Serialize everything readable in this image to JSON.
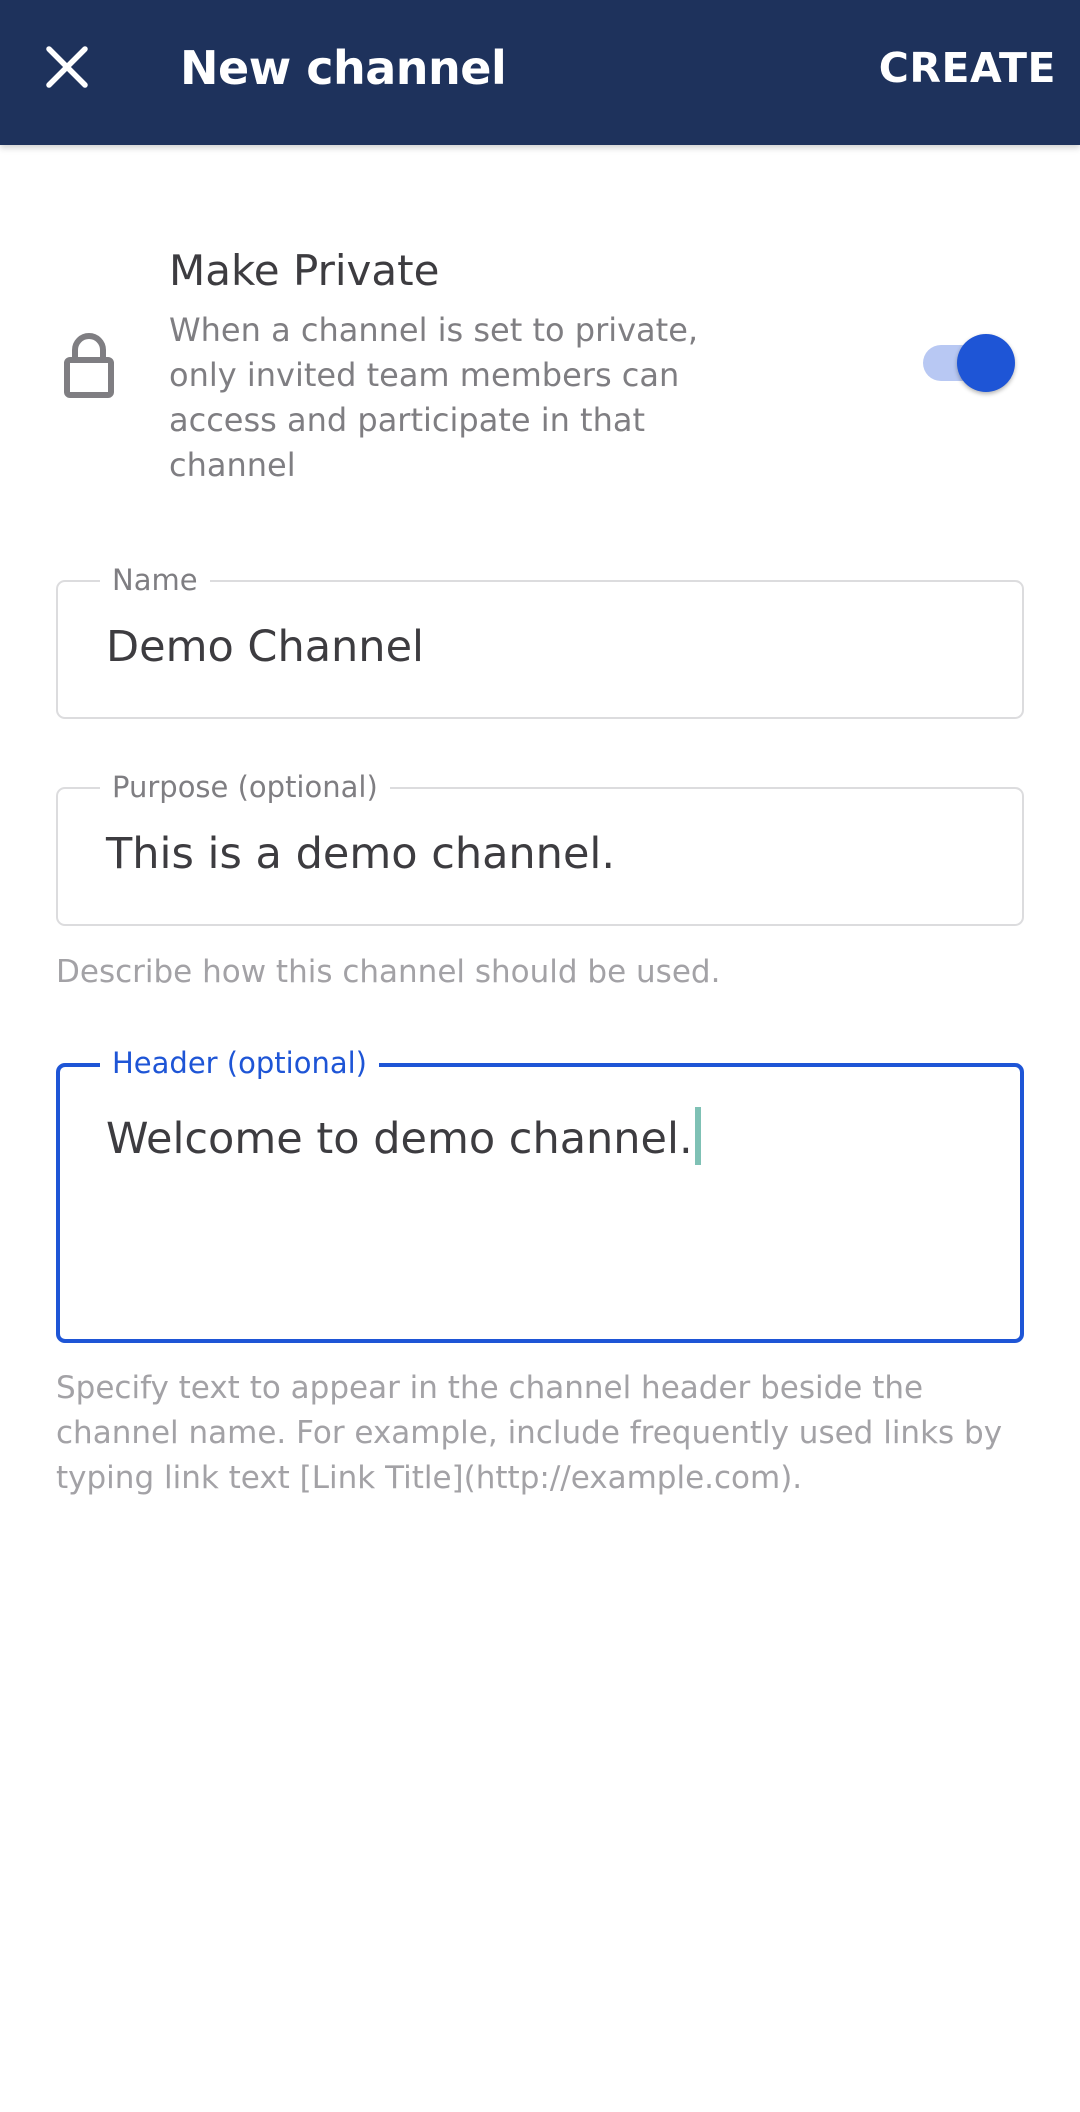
{
  "app_bar": {
    "title": "New channel",
    "create_label": "CREATE",
    "background_color": "#1e325c",
    "close_icon": "close-icon"
  },
  "make_private": {
    "title": "Make Private",
    "description": "When a channel is set to private, only invited team members can access and participate in that channel",
    "icon": "lock-icon",
    "enabled": true,
    "accent_color": "#1e55d6"
  },
  "fields": {
    "name": {
      "label": "Name",
      "value": "Demo Channel"
    },
    "purpose": {
      "label": "Purpose (optional)",
      "value": "This is a demo channel.",
      "help": "Describe how this channel should be used."
    },
    "header": {
      "label": "Header (optional)",
      "value": "Welcome to demo channel.",
      "focused": true,
      "help": "Specify text to appear in the channel header beside the channel name. For example, include frequently used links by typing link text [Link Title](http://example.com)."
    }
  }
}
